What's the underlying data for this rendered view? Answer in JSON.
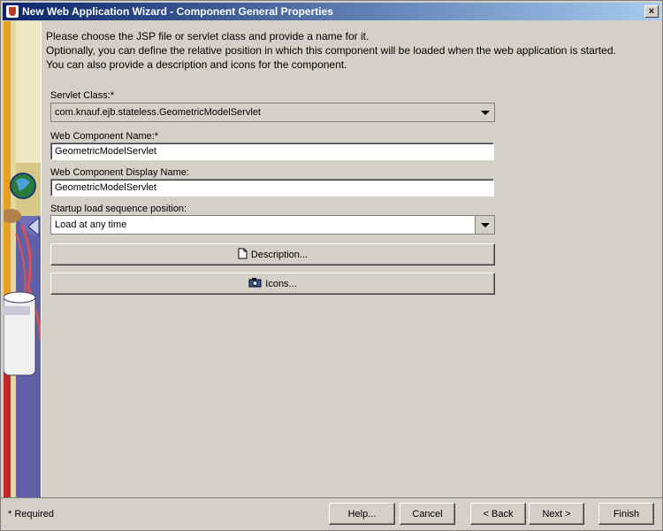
{
  "window": {
    "title": "New Web Application Wizard - Component General Properties",
    "close_label": "×"
  },
  "intro": {
    "line1": "Please choose the JSP file or servlet class and provide a name for it.",
    "line2": "Optionally, you can define the relative position in which this component will be loaded when the web application is started.",
    "line3": "You can also provide a description and icons for the component."
  },
  "form": {
    "servlet_class_label": "Servlet Class:*",
    "servlet_class_value": "com.knauf.ejb.stateless.GeometricModelServlet",
    "component_name_label": "Web Component Name:*",
    "component_name_value": "GeometricModelServlet",
    "display_name_label": "Web Component Display Name:",
    "display_name_value": "GeometricModelServlet",
    "startup_label": "Startup load sequence position:",
    "startup_value": "Load at any time",
    "description_button": "Description...",
    "icons_button": "Icons..."
  },
  "footer": {
    "required_note": "* Required",
    "help_button": "Help...",
    "cancel_button": "Cancel",
    "back_button": "< Back",
    "next_button": "Next >",
    "finish_button": "Finish"
  },
  "colors": {
    "titlebar_start": "#0a246a",
    "titlebar_end": "#a6caf0",
    "panel_bg": "#d4d0c8"
  }
}
